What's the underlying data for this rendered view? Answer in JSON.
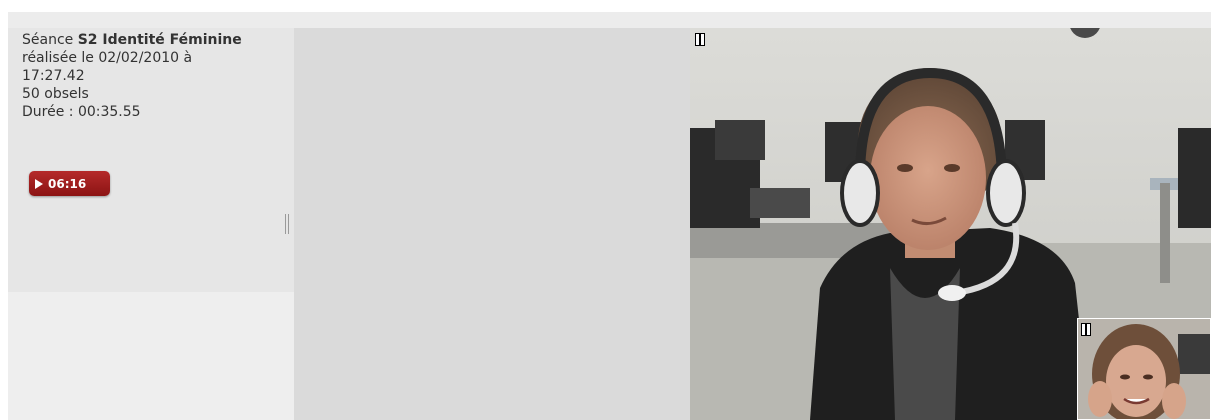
{
  "session": {
    "prefix": "Séance ",
    "title": "S2 Identité Féminine",
    "date_line": "réalisée le 02/02/2010 à",
    "time": "17:27.42",
    "obsels": "50 obsels",
    "duration": "Durée : 00:35.55"
  },
  "player": {
    "play_time": "06:16",
    "accent_color": "#a11f1f"
  },
  "icons": {
    "play": "play-icon",
    "pause": "pause-icon"
  },
  "videos": {
    "main_pause_icon": "pause-icon",
    "pip_pause_icon": "pause-icon"
  }
}
